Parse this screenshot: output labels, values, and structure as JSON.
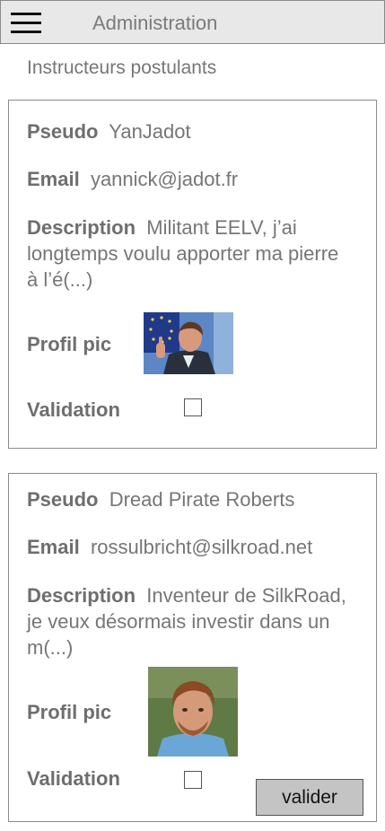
{
  "header": {
    "title": "Administration",
    "menu_icon": "hamburger-menu-icon"
  },
  "section": {
    "title": "Instructeurs postulants"
  },
  "labels": {
    "pseudo": "Pseudo",
    "email": "Email",
    "description": "Description",
    "profile_pic": "Profil pic",
    "validation": "Validation"
  },
  "applicants": [
    {
      "pseudo": "YanJadot",
      "email": "yannick@jadot.fr",
      "description": "Militant EELV, j’ai longtemps voulu apporter ma pierre à l’é(...)",
      "validated": false
    },
    {
      "pseudo": "Dread Pirate Roberts",
      "email": "rossulbricht@silkroad.net",
      "description": "Inventeur de SilkRoad, je veux désormais investir dans un m(...)",
      "validated": false
    }
  ],
  "actions": {
    "validate_label": "valider"
  },
  "colors": {
    "header_bg": "#e8e8e8",
    "button_bg": "#c4c4c4",
    "text": "#767676"
  }
}
